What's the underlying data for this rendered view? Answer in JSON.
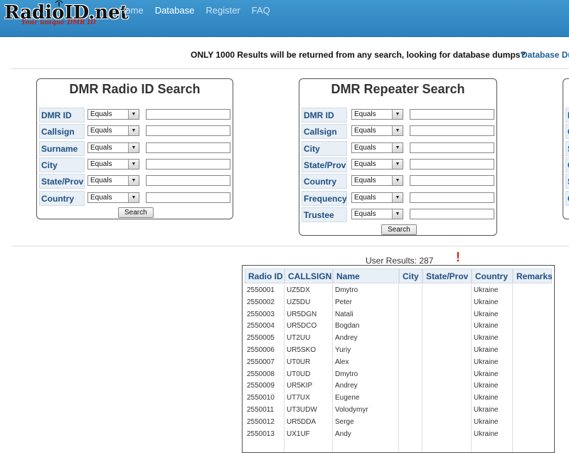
{
  "logo": {
    "text": "RadioID.net",
    "tagline": "Your unique DMR ID"
  },
  "nav": [
    "Home",
    "Database",
    "Register",
    "FAQ"
  ],
  "nav_active_index": 1,
  "notice": {
    "text": "ONLY 1000 Results will be returned from any search, looking for database dumps?",
    "link": "Database Du"
  },
  "radio_search": {
    "title": "DMR Radio ID Search",
    "fields": [
      {
        "label": "DMR ID",
        "operator": "Equals",
        "value": ""
      },
      {
        "label": "Callsign",
        "operator": "Equals",
        "value": ""
      },
      {
        "label": "Surname",
        "operator": "Equals",
        "value": ""
      },
      {
        "label": "City",
        "operator": "Equals",
        "value": ""
      },
      {
        "label": "State/Prov",
        "operator": "Equals",
        "value": ""
      },
      {
        "label": "Country",
        "operator": "Equals",
        "value": ""
      }
    ],
    "button": "Search"
  },
  "repeater_search": {
    "title": "DMR Repeater Search",
    "fields": [
      {
        "label": "DMR ID",
        "operator": "Equals",
        "value": ""
      },
      {
        "label": "Callsign",
        "operator": "Equals",
        "value": ""
      },
      {
        "label": "City",
        "operator": "Equals",
        "value": ""
      },
      {
        "label": "State/Prov",
        "operator": "Equals",
        "value": ""
      },
      {
        "label": "Country",
        "operator": "Equals",
        "value": ""
      },
      {
        "label": "Frequency",
        "operator": "Equals",
        "value": ""
      },
      {
        "label": "Trustee",
        "operator": "Equals",
        "value": ""
      }
    ],
    "button": "Search"
  },
  "third_panel_labels": [
    "N",
    "C",
    "S",
    "C",
    "S",
    "C"
  ],
  "results": {
    "label": "User Results: 287",
    "annotation": "!",
    "columns": [
      "Radio ID",
      "CALLSIGN",
      "Name",
      "City",
      "State/Prov",
      "Country",
      "Remarks"
    ],
    "rows": [
      [
        "2550001",
        "UZ5DX",
        "Dmytro",
        "",
        "",
        "Ukraine",
        ""
      ],
      [
        "2550002",
        "UZ5DU",
        "Peter",
        "",
        "",
        "Ukraine",
        ""
      ],
      [
        "2550003",
        "UR5DGN",
        "Natali",
        "",
        "",
        "Ukraine",
        ""
      ],
      [
        "2550004",
        "UR5DCO",
        "Bogdan",
        "",
        "",
        "Ukraine",
        ""
      ],
      [
        "2550005",
        "UT2UU",
        "Andrey",
        "",
        "",
        "Ukraine",
        ""
      ],
      [
        "2550006",
        "UR5SKO",
        "Yuriy",
        "",
        "",
        "Ukraine",
        ""
      ],
      [
        "2550007",
        "UT0UR",
        "Alex",
        "",
        "",
        "Ukraine",
        ""
      ],
      [
        "2550008",
        "UT0UD",
        "Dmytro",
        "",
        "",
        "Ukraine",
        ""
      ],
      [
        "2550009",
        "UR5KIP",
        "Andrey",
        "",
        "",
        "Ukraine",
        ""
      ],
      [
        "2550010",
        "UT7UX",
        "Eugene",
        "",
        "",
        "Ukraine",
        ""
      ],
      [
        "2550011",
        "UT3UDW",
        "Volodymyr",
        "",
        "",
        "Ukraine",
        ""
      ],
      [
        "2550012",
        "UR5DDA",
        "Serge",
        "",
        "",
        "Ukraine",
        ""
      ],
      [
        "2550013",
        "UX1UF",
        "Andy",
        "",
        "",
        "Ukraine",
        ""
      ]
    ]
  },
  "colors": {
    "navbar": "#2d82bd",
    "label_bg": "#e9eff6",
    "label_text": "#1d4f82",
    "annotation": "#e0201a"
  }
}
